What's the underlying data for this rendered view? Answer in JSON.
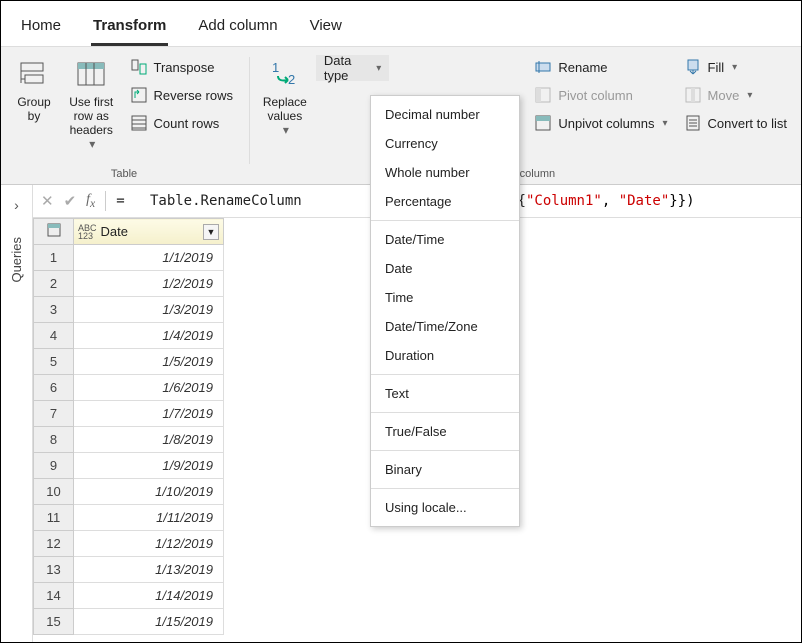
{
  "tabs": {
    "home": "Home",
    "transform": "Transform",
    "addcolumn": "Add column",
    "view": "View"
  },
  "ribbon": {
    "groupby": "Group\nby",
    "usefirstrow": "Use first row as\nheaders",
    "transpose": "Transpose",
    "reverserows": "Reverse rows",
    "countrows": "Count rows",
    "tablegroup": "Table",
    "replacevalues": "Replace\nvalues",
    "datatype": "Data type",
    "rename": "Rename",
    "pivotcolumn": "Pivot column",
    "unpivotcolumns": "Unpivot columns",
    "fill": "Fill",
    "move": "Move",
    "converttolist": "Convert to list",
    "anycolumn": "Any column"
  },
  "formula": {
    "eq": "=",
    "prefix": "Table.RenameColumn",
    "mid": "table\", {{",
    "str1": "\"Column1\"",
    "comma": ", ",
    "str2": "\"Date\"",
    "suffix": "}})"
  },
  "sidebar": {
    "queries": "Queries"
  },
  "column": {
    "header": "Date"
  },
  "rows": [
    {
      "n": "1",
      "v": "1/1/2019"
    },
    {
      "n": "2",
      "v": "1/2/2019"
    },
    {
      "n": "3",
      "v": "1/3/2019"
    },
    {
      "n": "4",
      "v": "1/4/2019"
    },
    {
      "n": "5",
      "v": "1/5/2019"
    },
    {
      "n": "6",
      "v": "1/6/2019"
    },
    {
      "n": "7",
      "v": "1/7/2019"
    },
    {
      "n": "8",
      "v": "1/8/2019"
    },
    {
      "n": "9",
      "v": "1/9/2019"
    },
    {
      "n": "10",
      "v": "1/10/2019"
    },
    {
      "n": "11",
      "v": "1/11/2019"
    },
    {
      "n": "12",
      "v": "1/12/2019"
    },
    {
      "n": "13",
      "v": "1/13/2019"
    },
    {
      "n": "14",
      "v": "1/14/2019"
    },
    {
      "n": "15",
      "v": "1/15/2019"
    }
  ],
  "menu": {
    "decimal": "Decimal number",
    "currency": "Currency",
    "whole": "Whole number",
    "percentage": "Percentage",
    "datetime": "Date/Time",
    "date": "Date",
    "time": "Time",
    "dtz": "Date/Time/Zone",
    "duration": "Duration",
    "text": "Text",
    "truefalse": "True/False",
    "binary": "Binary",
    "locale": "Using locale..."
  }
}
